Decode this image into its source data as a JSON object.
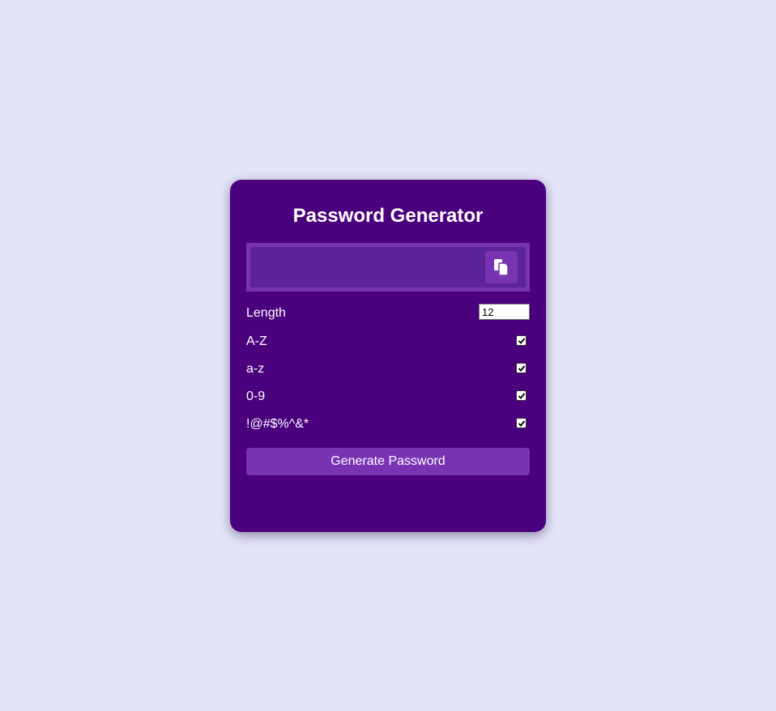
{
  "title": "Password Generator",
  "result": {
    "text": "",
    "copy_icon": "clipboard-icon"
  },
  "settings": {
    "length": {
      "label": "Length",
      "value": "12"
    },
    "uppercase": {
      "label": "A-Z",
      "checked": true
    },
    "lowercase": {
      "label": "a-z",
      "checked": true
    },
    "numbers": {
      "label": "0-9",
      "checked": true
    },
    "symbols": {
      "label": "!@#$%^&*",
      "checked": true
    }
  },
  "generate_label": "Generate Password",
  "colors": {
    "background": "#e4e4f8",
    "card": "#4b007d",
    "accent": "#7833b3",
    "result_bg": "#5c2499"
  }
}
